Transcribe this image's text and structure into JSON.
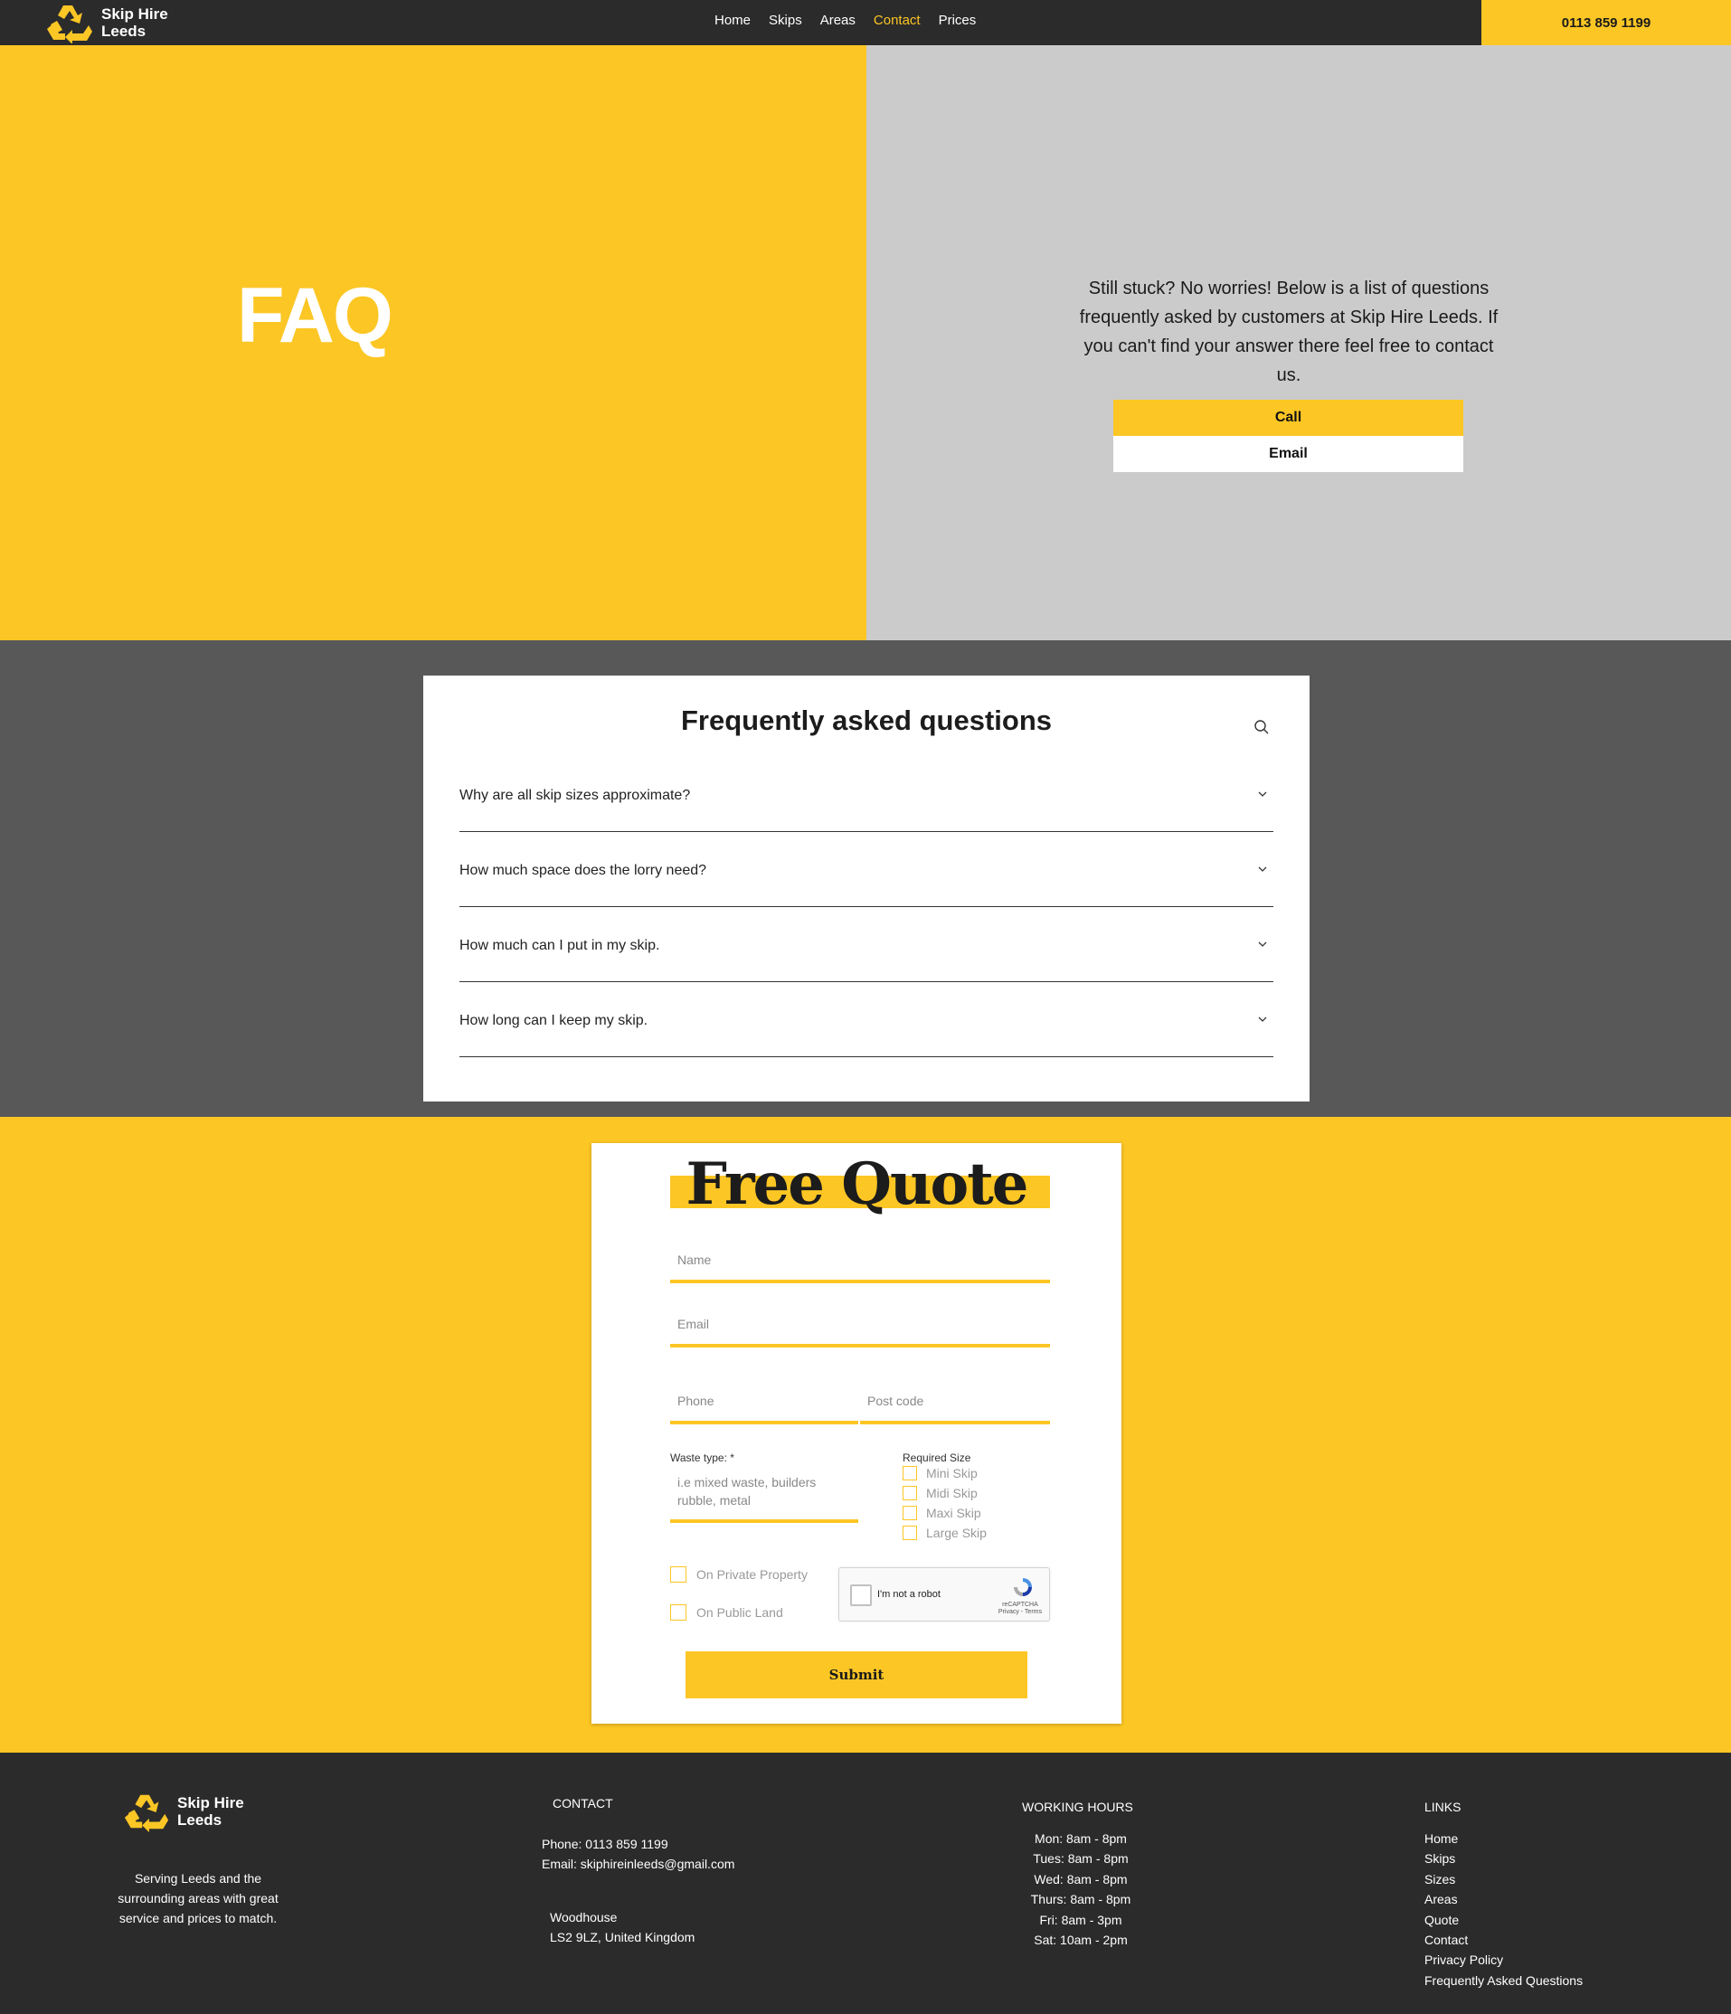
{
  "brand": {
    "name_line1": "Skip Hire",
    "name_line2": "Leeds",
    "logo_icon": "recycle-icon",
    "accent": "#fcc625",
    "dark": "#2b2b2b"
  },
  "nav": {
    "items": [
      {
        "label": "Home"
      },
      {
        "label": "Skips"
      },
      {
        "label": "Areas"
      },
      {
        "label": "Contact"
      },
      {
        "label": "Prices"
      }
    ],
    "phone": "0113 859 1199"
  },
  "hero": {
    "title": "FAQ",
    "text": "Still stuck? No worries! Below is a list of questions frequently asked by customers at Skip Hire Leeds. If you can't find your answer there feel free to contact us.",
    "call_label": "Call",
    "email_label": "Email"
  },
  "faq": {
    "title": "Frequently asked questions",
    "search_icon": "search-icon",
    "questions": [
      {
        "q": "Why are all skip sizes approximate?"
      },
      {
        "q": "How much space does the lorry need?"
      },
      {
        "q": "How much can I put in my skip."
      },
      {
        "q": "How long can I keep my skip."
      }
    ]
  },
  "quote": {
    "title": "Free Quote",
    "name_placeholder": "Name",
    "email_placeholder": "Email",
    "phone_placeholder": "Phone",
    "postcode_placeholder": "Post code",
    "waste_label": "Waste type: *",
    "waste_placeholder_line1": "i.e mixed waste, builders",
    "waste_placeholder_line2": "rubble, metal",
    "size_label": "Required Size",
    "sizes": [
      {
        "label": "Mini Skip"
      },
      {
        "label": "Midi Skip"
      },
      {
        "label": "Maxi Skip"
      },
      {
        "label": "Large Skip"
      }
    ],
    "location": [
      {
        "label": "On Private Property"
      },
      {
        "label": "On Public Land"
      }
    ],
    "captcha_label": "I'm not a robot",
    "captcha_brand": "reCAPTCHA",
    "captcha_links": "Privacy - Terms",
    "submit_label": "Submit"
  },
  "footer": {
    "tagline": "Serving Leeds and the surrounding areas with great service and prices to match.",
    "contact_heading": "CONTACT",
    "phone_line": "Phone: 0113 859 1199",
    "email_line": "Email: skiphireinleeds@gmail.com",
    "address_line1": "Woodhouse",
    "address_line2": "LS2 9LZ, United Kingdom",
    "hours_heading": "WORKING HOURS",
    "hours": [
      {
        "text": "Mon: 8am - 8pm"
      },
      {
        "text": "Tues: 8am - 8pm"
      },
      {
        "text": "Wed: 8am - 8pm"
      },
      {
        "text": "Thurs: 8am - 8pm"
      },
      {
        "text": "Fri: 8am - 3pm"
      },
      {
        "text": "Sat: 10am - 2pm"
      }
    ],
    "links_heading": "LINKS",
    "links": [
      {
        "label": "Home"
      },
      {
        "label": "Skips"
      },
      {
        "label": "Sizes"
      },
      {
        "label": "Areas"
      },
      {
        "label": "Quote"
      },
      {
        "label": "Contact"
      },
      {
        "label": "Privacy Policy"
      },
      {
        "label": "Frequently Asked Questions"
      }
    ]
  }
}
